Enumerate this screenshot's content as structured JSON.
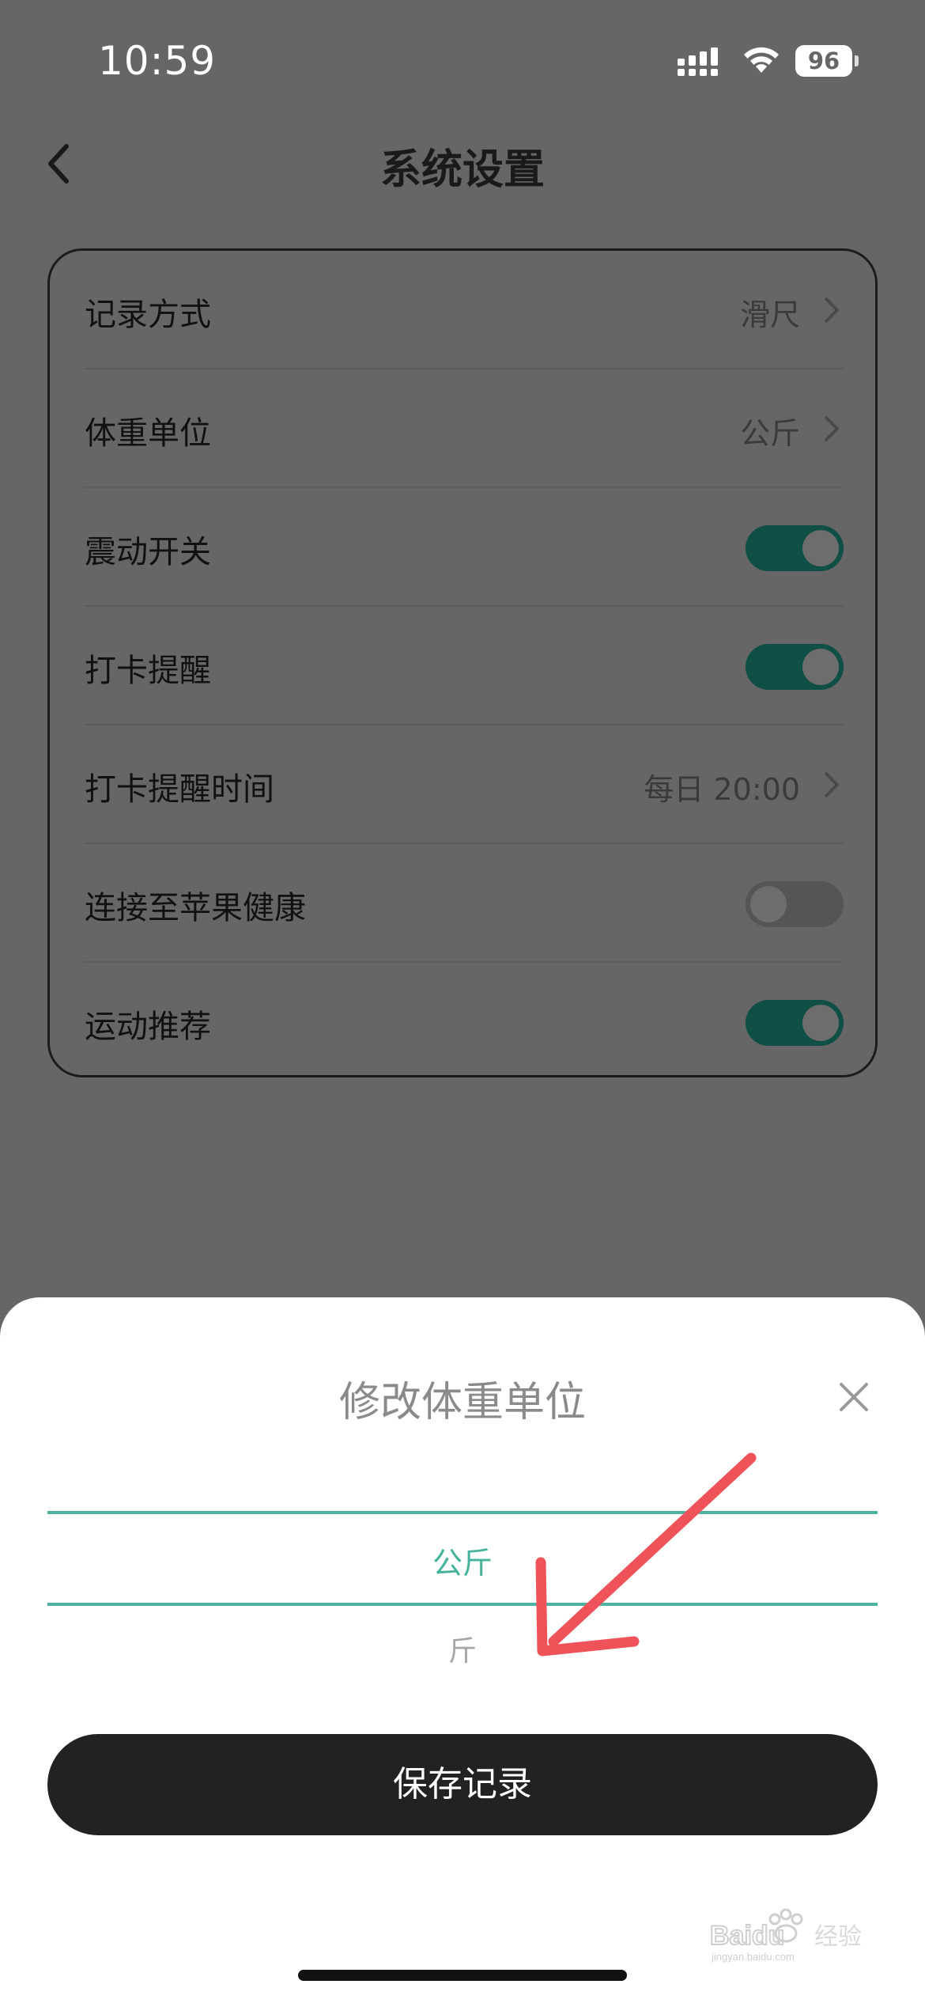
{
  "status_bar": {
    "time": "10:59",
    "battery": "96"
  },
  "header": {
    "title": "系统设置"
  },
  "settings": {
    "rows": [
      {
        "label": "记录方式",
        "value": "滑尺"
      },
      {
        "label": "体重单位",
        "value": "公斤"
      },
      {
        "label": "震动开关",
        "toggle_on": true
      },
      {
        "label": "打卡提醒",
        "toggle_on": true
      },
      {
        "label": "打卡提醒时间",
        "value": "每日 20:00"
      },
      {
        "label": "连接至苹果健康",
        "toggle_on": false
      },
      {
        "label": "运动推荐",
        "toggle_on": true
      }
    ]
  },
  "sheet": {
    "title": "修改体重单位",
    "selected_option": "公斤",
    "other_option": "斤",
    "save_label": "保存记录"
  },
  "colors": {
    "accent": "#4db3a0",
    "toggle_on": "#0f4f45",
    "annotation_arrow": "#f0525a",
    "button_bg": "#222222"
  },
  "watermark": {
    "brand": "Baidu",
    "text": "经验",
    "site": "jingyan.baidu.com"
  }
}
